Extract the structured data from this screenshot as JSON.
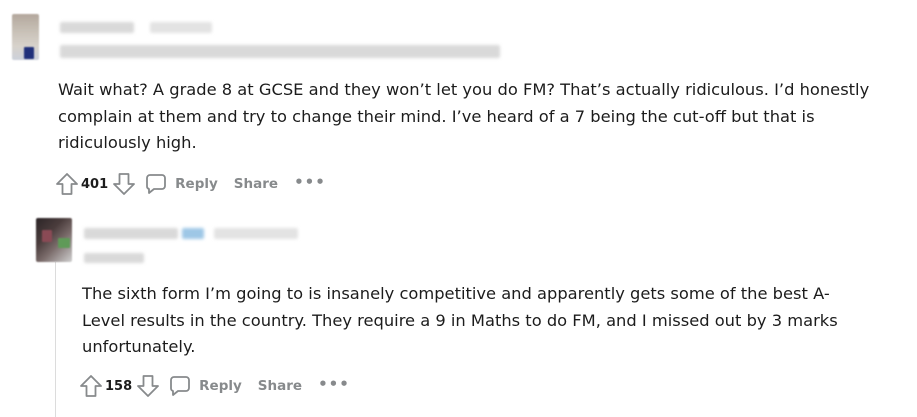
{
  "comments": [
    {
      "text": "Wait what? A grade 8 at GCSE and they won’t let you do FM? That’s actually ridiculous. I’d honestly complain at them and try to change their mind. I’ve heard of a 7 being the cut-off but that is ridiculously high.",
      "score": "401",
      "reply_label": "Reply",
      "share_label": "Share",
      "more_label": "•••"
    },
    {
      "text": "The sixth form I’m going to is insanely competitive and apparently gets some of the best A-Level results in the country. They require a 9 in Maths to do FM, and I missed out by 3 marks unfortunately.",
      "score": "158",
      "reply_label": "Reply",
      "share_label": "Share",
      "more_label": "•••"
    }
  ],
  "icons": {
    "upvote": "arrow-up-icon",
    "downvote": "arrow-down-icon",
    "reply": "speech-bubble-icon",
    "more": "ellipsis-icon"
  },
  "colors": {
    "text": "#1c1c1c",
    "muted": "#878a8c",
    "thread_line": "#dcdcdc"
  }
}
